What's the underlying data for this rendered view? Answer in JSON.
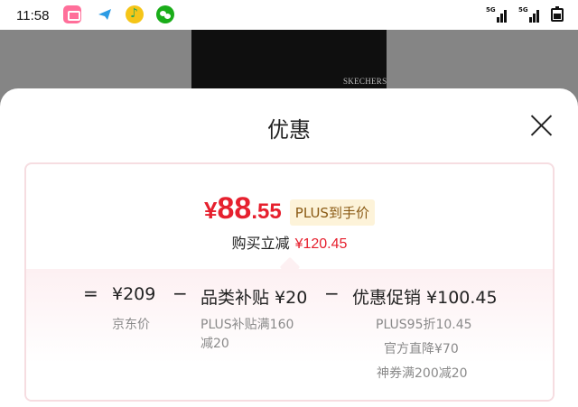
{
  "status_bar": {
    "time": "11:58",
    "signal_1": "5G",
    "signal_2": "5G"
  },
  "backdrop": {
    "product_brand": "SKECHERS"
  },
  "sheet": {
    "title": "优惠",
    "price_currency": "¥",
    "price_integer": "88",
    "price_decimal": ".55",
    "plus_tag": "PLUS到手价",
    "reduce_label": "购买立减",
    "reduce_amount": "¥120.45",
    "breakdown": {
      "equals": "=",
      "minus": "−",
      "base_price": "¥209",
      "base_label": "京东价",
      "category_subsidy": "品类补贴 ¥20",
      "category_detail_1": "PLUS补贴满160",
      "category_detail_2": "减20",
      "promo": "优惠促销 ¥100.45",
      "promo_detail_1": "PLUS95折10.45",
      "promo_detail_2": "官方直降¥70",
      "promo_detail_3": "神券满200减20"
    }
  },
  "colors": {
    "accent_red": "#e6202e",
    "plus_tag_bg": "#fdf3d9",
    "plus_tag_text": "#8a5a14",
    "card_border": "#f6dde1"
  }
}
